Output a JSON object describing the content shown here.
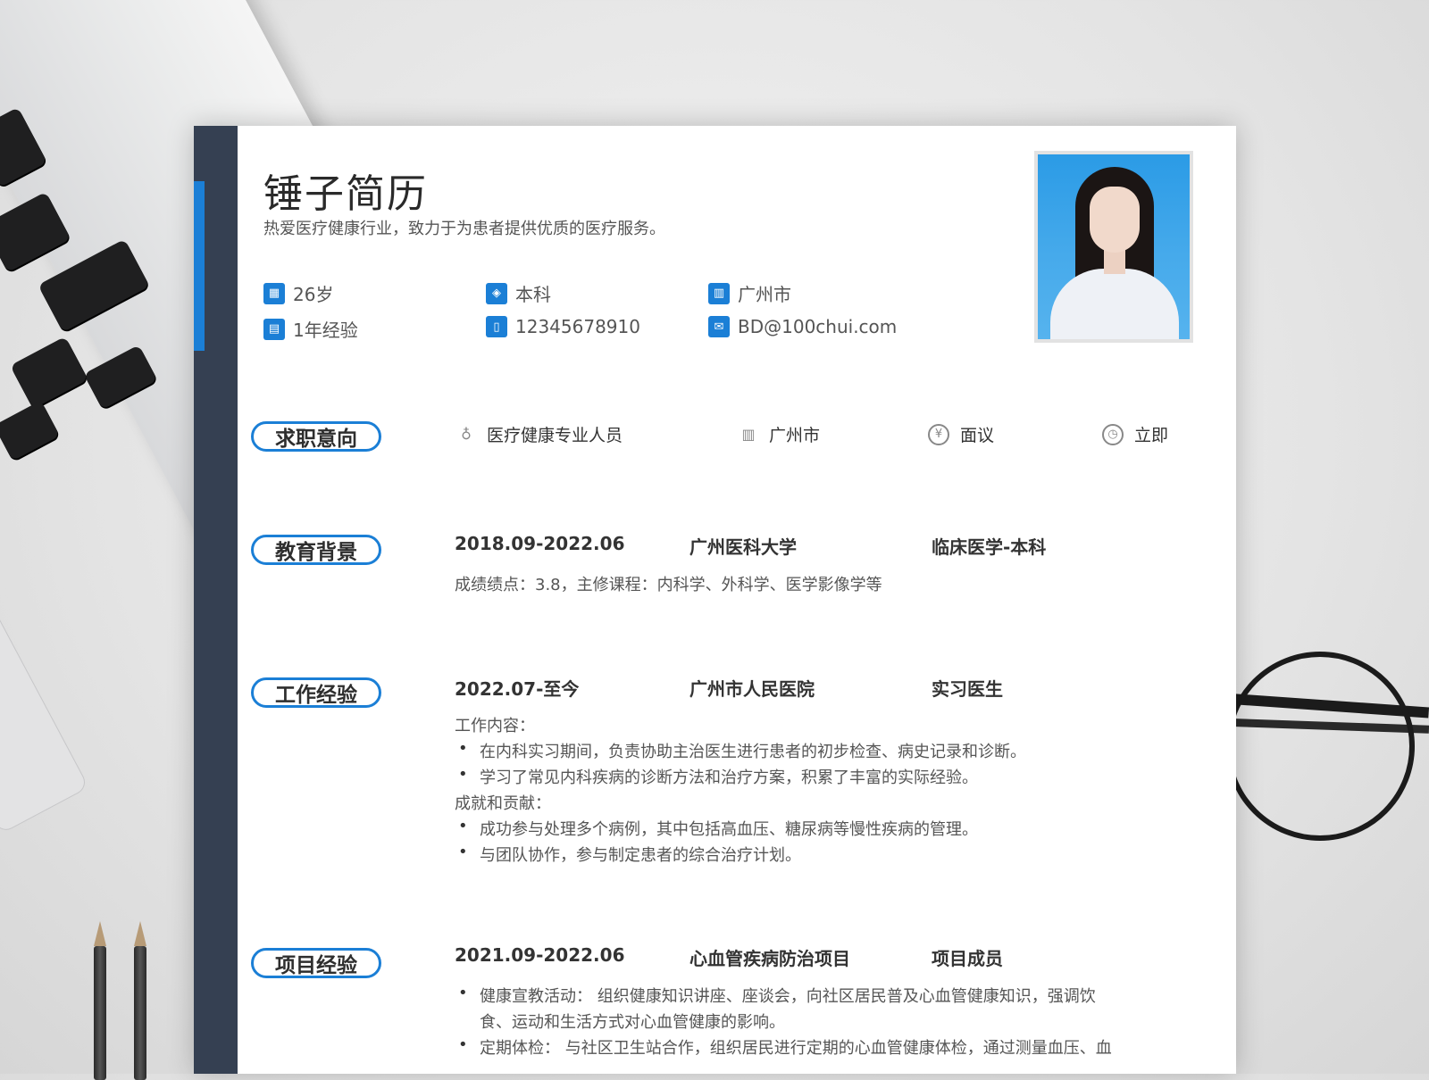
{
  "resume": {
    "name": "锤子简历",
    "tagline": "热爱医疗健康行业，致力于为患者提供优质的医疗服务。",
    "info": {
      "age": "26岁",
      "education": "本科",
      "city": "广州市",
      "experience": "1年经验",
      "phone": "12345678910",
      "email": "BD@100chui.com"
    }
  },
  "intent": {
    "title": "求职意向",
    "position": "医疗健康专业人员",
    "city": "广州市",
    "salary": "面议",
    "availability": "立即"
  },
  "education": {
    "title": "教育背景",
    "period": "2018.09-2022.06",
    "school": "广州医科大学",
    "major": "临床医学-本科",
    "detail": "成绩绩点：3.8，主修课程：内科学、外科学、医学影像学等"
  },
  "work": {
    "title": "工作经验",
    "period": "2022.07-至今",
    "company": "广州市人民医院",
    "role": "实习医生",
    "content_label": "工作内容：",
    "content_items": [
      "在内科实习期间，负责协助主治医生进行患者的初步检查、病史记录和诊断。",
      "学习了常见内科疾病的诊断方法和治疗方案，积累了丰富的实际经验。"
    ],
    "achieve_label": "成就和贡献：",
    "achieve_items": [
      "成功参与处理多个病例，其中包括高血压、糖尿病等慢性疾病的管理。",
      "与团队协作，参与制定患者的综合治疗计划。"
    ]
  },
  "project": {
    "title": "项目经验",
    "period": "2021.09-2022.06",
    "name": "心血管疾病防治项目",
    "role": "项目成员",
    "items": [
      "健康宣教活动： 组织健康知识讲座、座谈会，向社区居民普及心血管健康知识，强调饮",
      "食、运动和生活方式对心血管健康的影响。",
      "定期体检： 与社区卫生站合作，组织居民进行定期的心血管健康体检，通过测量血压、血"
    ]
  },
  "colors": {
    "accent": "#1b7fd6",
    "sidebar": "#354052"
  },
  "icons": {
    "age": "calendar-icon",
    "education": "graduation-cap-icon",
    "city": "building-icon",
    "experience": "document-icon",
    "phone": "phone-icon",
    "email": "mail-icon",
    "position": "tie-icon",
    "intent_city": "building-outline-icon",
    "salary": "yen-icon",
    "availability": "clock-icon"
  }
}
